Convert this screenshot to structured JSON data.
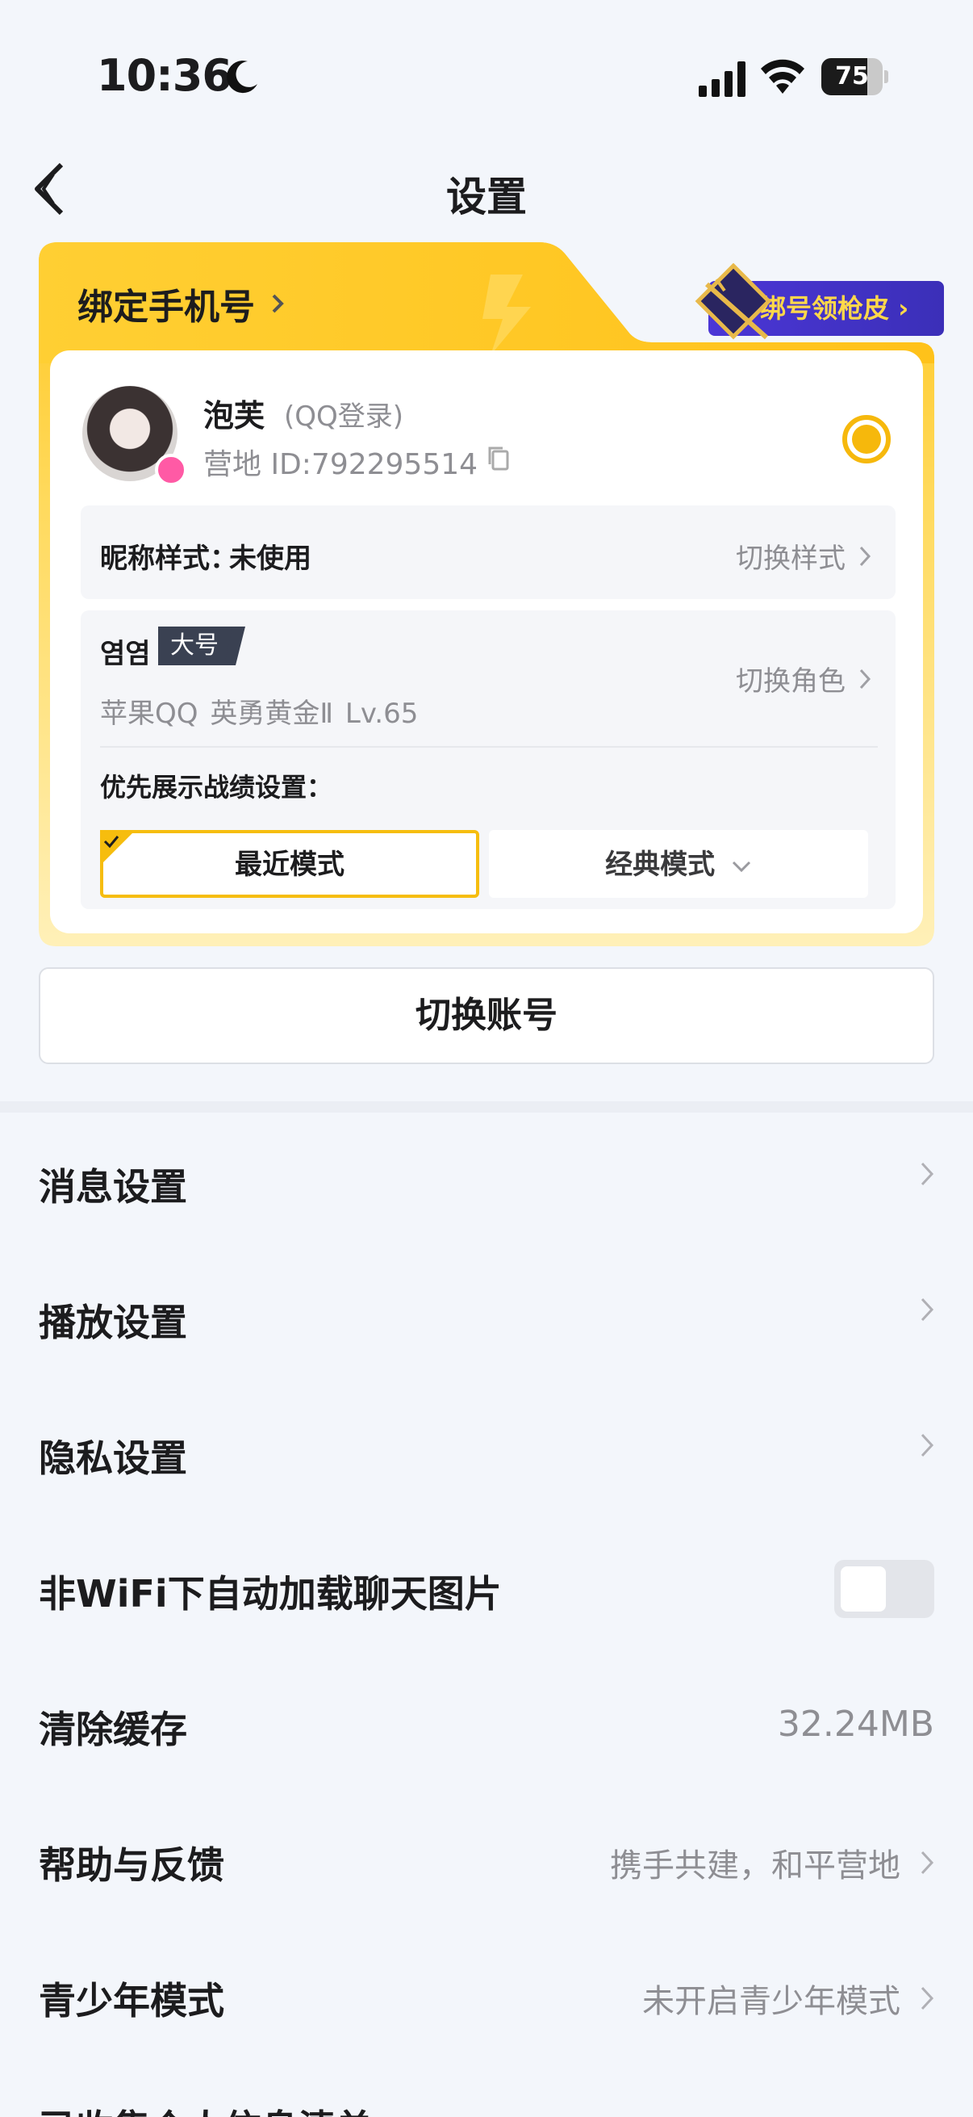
{
  "status_bar": {
    "time": "10:36",
    "battery": "75",
    "battery_level": 0.75
  },
  "nav": {
    "title": "设置"
  },
  "bind_card": {
    "bind_phone_label": "绑定手机号",
    "promo_label": "绑号领枪皮",
    "profile": {
      "nickname": "泡芙",
      "login_type": "(QQ登录)",
      "camp_id": "营地 ID:792295514"
    },
    "nickname_style": {
      "label": "昵称样式：",
      "value": "未使用",
      "action": "切换样式"
    },
    "role": {
      "name": "염염",
      "tag": "大号",
      "detail": "苹果QQ  英勇黄金Ⅱ  Lv.65",
      "action": "切换角色",
      "priority_label": "优先展示战绩设置：",
      "mode_recent": "最近模式",
      "mode_classic": "经典模式"
    }
  },
  "switch_account_label": "切换账号",
  "settings": [
    {
      "label": "消息设置",
      "value": ""
    },
    {
      "label": "播放设置",
      "value": ""
    },
    {
      "label": "隐私设置",
      "value": ""
    },
    {
      "label": "非WiFi下自动加载聊天图片",
      "toggle": false
    },
    {
      "label": "清除缓存",
      "value": "32.24MB"
    },
    {
      "label": "帮助与反馈",
      "value": "携手共建，和平营地"
    },
    {
      "label": "青少年模式",
      "value": "未开启青少年模式"
    }
  ],
  "cut_off_row": "已收集个人信息清单"
}
